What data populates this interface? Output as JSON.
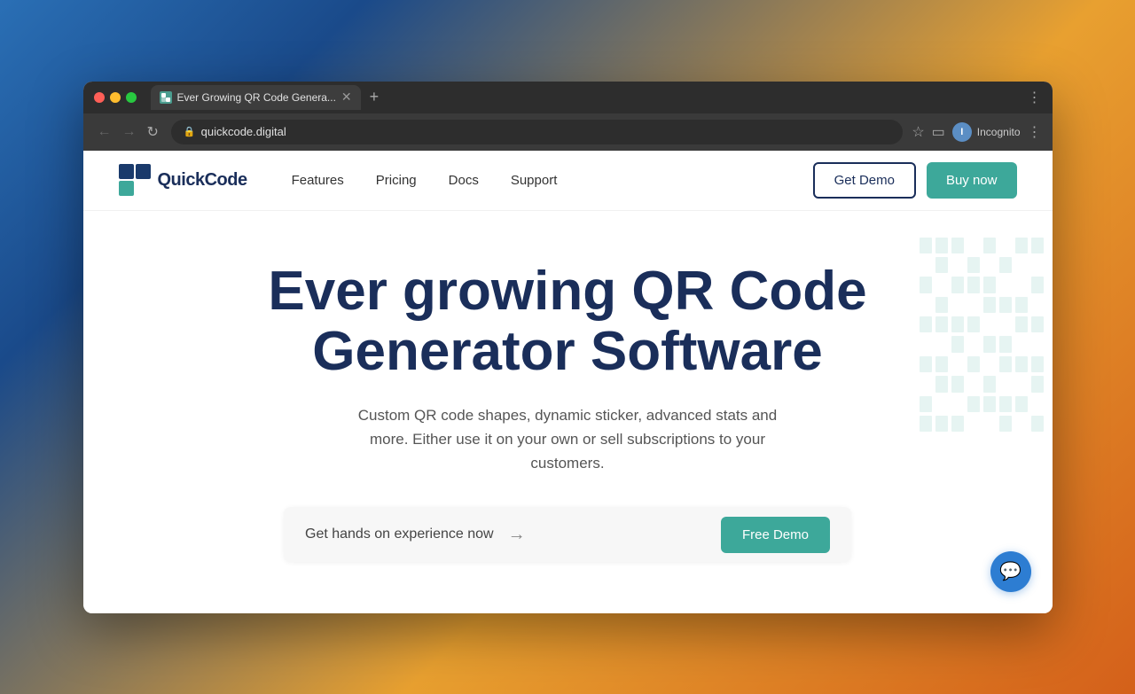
{
  "browser": {
    "tab_title": "Ever Growing QR Code Genera...",
    "url": "quickcode.digital",
    "profile_name": "Incognito"
  },
  "nav": {
    "logo_text": "QuickCode",
    "links": [
      {
        "label": "Features"
      },
      {
        "label": "Pricing"
      },
      {
        "label": "Docs"
      },
      {
        "label": "Support"
      }
    ],
    "btn_demo": "Get Demo",
    "btn_buy": "Buy now"
  },
  "hero": {
    "title_line1": "Ever growing QR Code",
    "title_line2": "Generator Software",
    "subtitle": "Custom QR code shapes, dynamic sticker, advanced stats and more. Either use it on your own or sell subscriptions to your customers.",
    "cta_placeholder": "Get hands on experience now",
    "cta_button": "Free Demo"
  }
}
